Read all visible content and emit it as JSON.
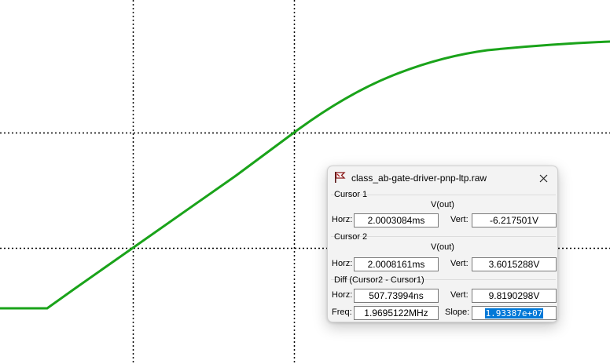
{
  "plot": {
    "background": "#ffffff",
    "trace_color": "#1aa31a",
    "grid_color": "#000000"
  },
  "window": {
    "title": "class_ab-gate-driver-pnp-ltp.raw",
    "app_icon": "ltspice-flag-icon",
    "close_icon": "close-icon"
  },
  "cursor1": {
    "label": "Cursor 1",
    "trace": "V(out)",
    "horz_label": "Horz:",
    "horz_value": "2.0003084ms",
    "vert_label": "Vert:",
    "vert_value": "-6.217501V"
  },
  "cursor2": {
    "label": "Cursor 2",
    "trace": "V(out)",
    "horz_label": "Horz:",
    "horz_value": "2.0008161ms",
    "vert_label": "Vert:",
    "vert_value": "3.6015288V"
  },
  "diff": {
    "label": "Diff (Cursor2 - Cursor1)",
    "horz_label": "Horz:",
    "horz_value": "507.73994ns",
    "vert_label": "Vert:",
    "vert_value": "9.8190298V",
    "freq_label": "Freq:",
    "freq_value": "1.9695122MHz",
    "slope_label": "Slope:",
    "slope_value": "1.93387e+07"
  }
}
